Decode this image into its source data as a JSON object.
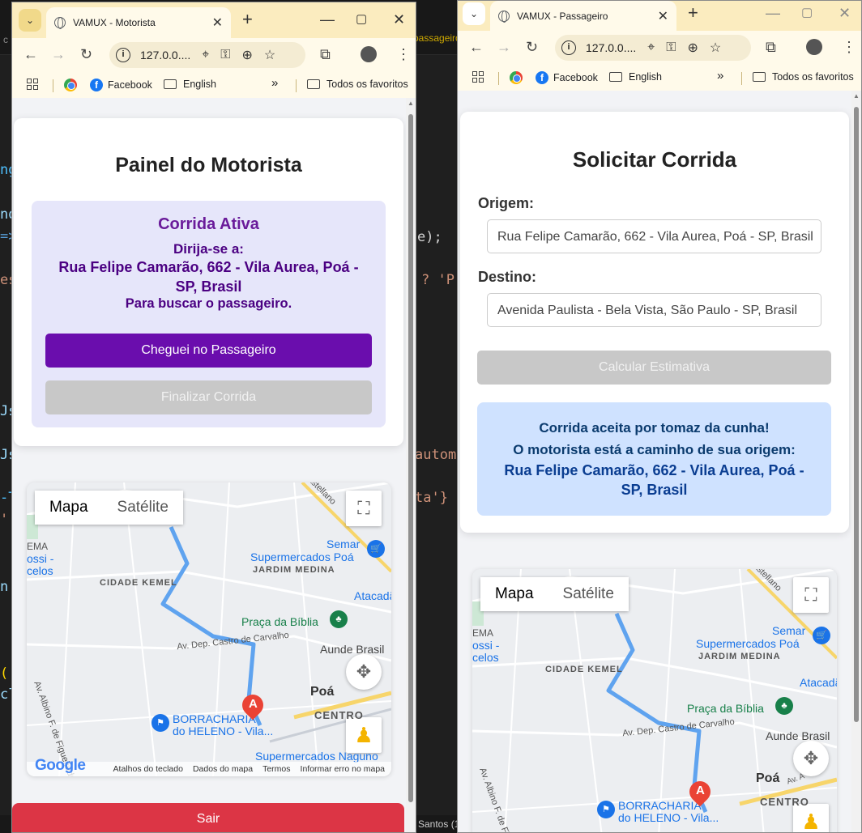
{
  "editor": {
    "fragments": {
      "f1": "ng",
      "f2": "nd",
      "f3": "=>",
      "f4": "es",
      "f5": "Js",
      "f6": "Js",
      "f7": "-T",
      "f8": "'",
      "f9": "n.",
      "f10": "(",
      "f11": "cl",
      "r1": "e);",
      "r2": "? 'P",
      "r3": "autom",
      "r4": "ta'}",
      "tabfrag": "passageiro",
      "cfrag": "c",
      "status": "Santos (1"
    }
  },
  "driver_window": {
    "tab_title": "VAMUX - Motorista",
    "url": "127.0.0....",
    "bookmarks": {
      "facebook": "Facebook",
      "english": "English",
      "all": "Todos os favoritos",
      "more": "»"
    },
    "page": {
      "title": "Painel do Motorista",
      "active_title": "Corrida Ativa",
      "goto_label": "Dirija-se a:",
      "address": "Rua Felipe Camarão, 662 - Vila Aurea, Poá - SP, Brasil",
      "pickup_note": "Para buscar o passageiro.",
      "arrived_button": "Cheguei no Passageiro",
      "finish_button": "Finalizar Corrida",
      "logout_button": "Sair"
    }
  },
  "passenger_window": {
    "tab_title": "VAMUX - Passageiro",
    "url": "127.0.0....",
    "bookmarks": {
      "facebook": "Facebook",
      "english": "English",
      "all": "Todos os favoritos",
      "more": "»"
    },
    "page": {
      "title": "Solicitar Corrida",
      "origin_label": "Origem:",
      "origin_value": "Rua Felipe Camarão, 662 - Vila Aurea, Poá - SP, Brasil",
      "destination_label": "Destino:",
      "destination_value": "Avenida Paulista - Bela Vista, São Paulo - SP, Brasil",
      "estimate_button": "Calcular Estimativa",
      "accepted_msg": "Corrida aceita por tomaz da cunha!",
      "on_the_way_msg": "O motorista está a caminho de sua origem:",
      "address": "Rua Felipe Camarão, 662 - Vila Aurea, Poá - SP, Brasil"
    }
  },
  "map": {
    "map_tab": "Mapa",
    "satellite_tab": "Satélite",
    "labels": {
      "castellano": "astellano",
      "semar": "Semar",
      "supermercados_poa": "Supermercados Poá",
      "jardim_medina": "JARDIM MEDINA",
      "cidade_kemel": "CIDADE KEMEL",
      "atacadao": "Atacadão -",
      "praca_biblia": "Praça da Bíblia",
      "av_castro": "Av. Dep. Castro de Carvalho",
      "aunde_brasil": "Aunde Brasil",
      "av_albino": "Av. Albino F. de Figueiredo",
      "poa": "Poá",
      "centro": "CENTRO",
      "borracharia": "BORRACHARIA",
      "do_heleno": "do HELENO - Vila...",
      "supermercados_naguno": "Supermercados Naguno",
      "ema": "EMA",
      "ossi": "ossi -",
      "celos": "celos",
      "marker": "A",
      "av_a": "Av. A"
    },
    "footer": {
      "shortcuts": "Atalhos do teclado",
      "data": "Dados do mapa",
      "terms": "Termos",
      "report": "Informar erro no mapa"
    },
    "google": "Google"
  },
  "colors": {
    "purple": "#6a0dad",
    "red": "#dc3545",
    "route": "#5fa3ef",
    "info": "#cfe2ff",
    "active_bg": "#e6e6fa"
  }
}
